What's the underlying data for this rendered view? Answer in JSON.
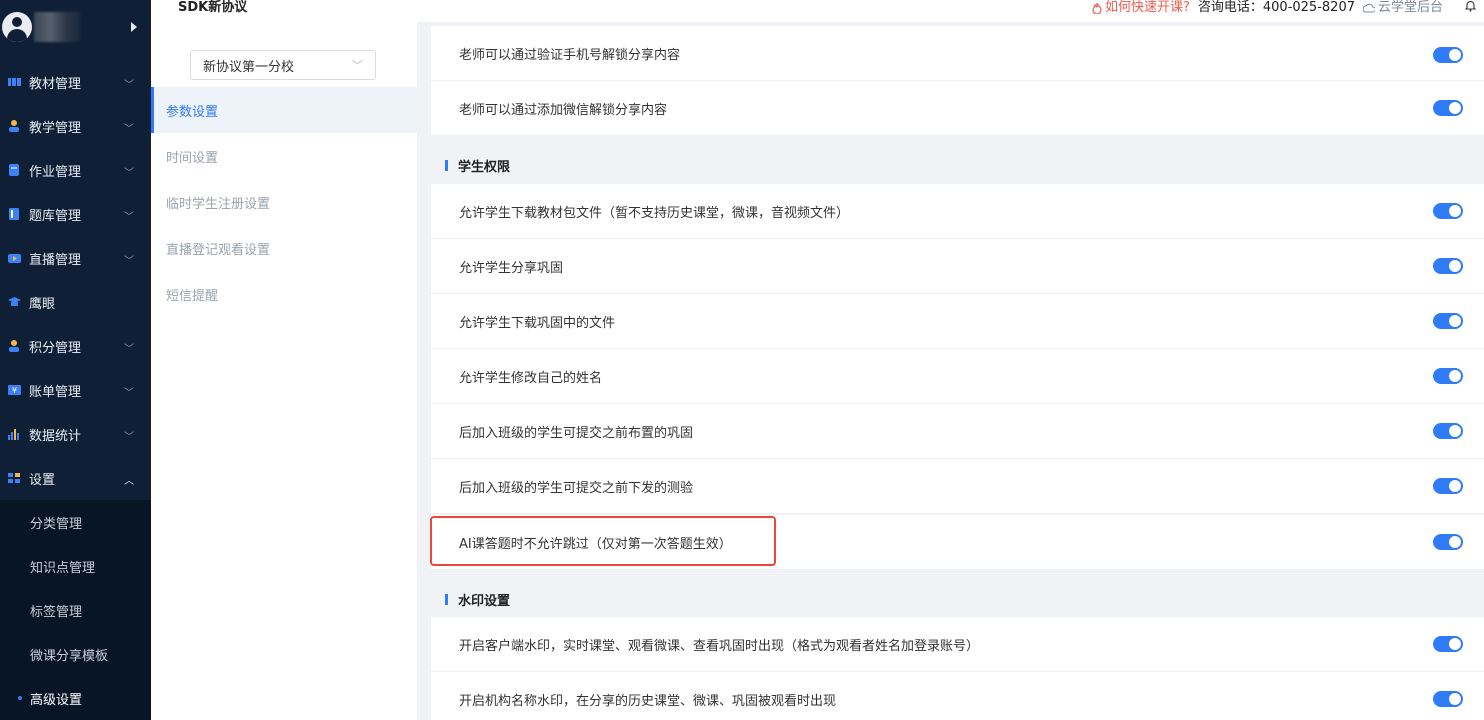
{
  "header": {
    "title": "SDK新协议",
    "quick_link": "如何快速开课?",
    "phone": "咨询电话：400-025-8207",
    "cloud_link": "云学堂后台"
  },
  "sidebar": {
    "items": [
      {
        "label": "教材管理",
        "icon": "book-icon"
      },
      {
        "label": "教学管理",
        "icon": "teacher-icon"
      },
      {
        "label": "作业管理",
        "icon": "homework-icon"
      },
      {
        "label": "题库管理",
        "icon": "question-bank-icon"
      },
      {
        "label": "直播管理",
        "icon": "live-icon"
      },
      {
        "label": "鹰眼",
        "icon": "graduation-cap-icon"
      },
      {
        "label": "积分管理",
        "icon": "points-icon"
      },
      {
        "label": "账单管理",
        "icon": "bill-icon"
      },
      {
        "label": "数据统计",
        "icon": "bar-chart-icon"
      },
      {
        "label": "设置",
        "icon": "settings-grid-icon"
      }
    ],
    "settings_children": [
      "分类管理",
      "知识点管理",
      "标签管理",
      "微课分享模板",
      "高级设置"
    ]
  },
  "subnav": {
    "school": "新协议第一分校",
    "items": [
      "参数设置",
      "时间设置",
      "临时学生注册设置",
      "直播登记观看设置",
      "短信提醒"
    ]
  },
  "settings": {
    "top_rows": [
      "老师可以通过验证手机号解锁分享内容",
      "老师可以通过添加微信解锁分享内容"
    ],
    "student_section": "学生权限",
    "student_rows": [
      "允许学生下载教材包文件（暂不支持历史课堂，微课，音视频文件）",
      "允许学生分享巩固",
      "允许学生下载巩固中的文件",
      "允许学生修改自己的姓名",
      "后加入班级的学生可提交之前布置的巩固",
      "后加入班级的学生可提交之前下发的测验",
      "AI课答题时不允许跳过（仅对第一次答题生效）"
    ],
    "watermark_section": "水印设置",
    "watermark_rows": [
      "开启客户端水印，实时课堂、观看微课、查看巩固时出现（格式为观看者姓名加登录账号）",
      "开启机构名称水印，在分享的历史课堂、微课、巩固被观看时出现"
    ]
  },
  "colors": {
    "accent": "#2f7cf6",
    "sidebar_bg": "#0f2036",
    "highlight": "#e8473a",
    "quick_link": "#f25b4b"
  }
}
